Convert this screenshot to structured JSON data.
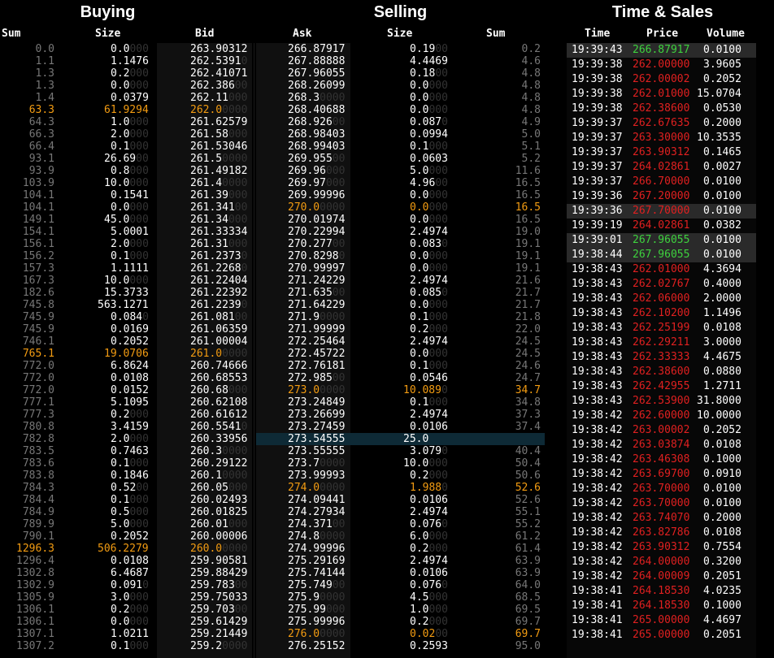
{
  "headers": {
    "buying": "Buying",
    "selling": "Selling",
    "time_sales": "Time & Sales"
  },
  "columns": {
    "buy_sum": "Sum",
    "buy_size": "Size",
    "bid": "Bid",
    "ask": "Ask",
    "sell_size": "Size",
    "sell_sum": "Sum",
    "time": "Time",
    "price": "Price",
    "volume": "Volume"
  },
  "colors": {
    "highlight": "#f39c12",
    "sell_price": "#e02020",
    "buy_price": "#3ed23e",
    "zero_pad": "#333333",
    "sum": "#777777"
  },
  "bids": [
    {
      "sum": "0.0",
      "size": "0.0",
      "size_pad": "000",
      "bid": "263.90312",
      "bid_pad": ""
    },
    {
      "sum": "1.1",
      "size": "1.1476",
      "size_pad": "",
      "bid": "262.5391",
      "bid_pad": "0"
    },
    {
      "sum": "1.3",
      "size": "0.2",
      "size_pad": "000",
      "bid": "262.41071",
      "bid_pad": ""
    },
    {
      "sum": "1.3",
      "size": "0.0",
      "size_pad": "000",
      "bid": "262.386",
      "bid_pad": "00"
    },
    {
      "sum": "1.4",
      "size": "0.0379",
      "size_pad": "",
      "bid": "262.11",
      "bid_pad": "000"
    },
    {
      "sum": "63.3",
      "size": "61.9294",
      "size_pad": "",
      "bid": "262.0",
      "bid_pad": "0000",
      "hl": true
    },
    {
      "sum": "64.3",
      "size": "1.0",
      "size_pad": "000",
      "bid": "261.62579",
      "bid_pad": ""
    },
    {
      "sum": "66.3",
      "size": "2.0",
      "size_pad": "000",
      "bid": "261.58",
      "bid_pad": "000"
    },
    {
      "sum": "66.4",
      "size": "0.1",
      "size_pad": "000",
      "bid": "261.53046",
      "bid_pad": ""
    },
    {
      "sum": "93.1",
      "size": "26.69",
      "size_pad": "00",
      "bid": "261.5",
      "bid_pad": "0000"
    },
    {
      "sum": "93.9",
      "size": "0.8",
      "size_pad": "000",
      "bid": "261.49182",
      "bid_pad": ""
    },
    {
      "sum": "103.9",
      "size": "10.0",
      "size_pad": "000",
      "bid": "261.4",
      "bid_pad": "0000"
    },
    {
      "sum": "104.1",
      "size": "0.1541",
      "size_pad": "",
      "bid": "261.39",
      "bid_pad": "000"
    },
    {
      "sum": "104.1",
      "size": "0.0",
      "size_pad": "000",
      "bid": "261.341",
      "bid_pad": "00"
    },
    {
      "sum": "149.1",
      "size": "45.0",
      "size_pad": "000",
      "bid": "261.34",
      "bid_pad": "000"
    },
    {
      "sum": "154.1",
      "size": "5.0001",
      "size_pad": "",
      "bid": "261.33334",
      "bid_pad": ""
    },
    {
      "sum": "156.1",
      "size": "2.0",
      "size_pad": "000",
      "bid": "261.31",
      "bid_pad": "000"
    },
    {
      "sum": "156.2",
      "size": "0.1",
      "size_pad": "000",
      "bid": "261.2373",
      "bid_pad": "0"
    },
    {
      "sum": "157.3",
      "size": "1.1111",
      "size_pad": "",
      "bid": "261.2268",
      "bid_pad": "0"
    },
    {
      "sum": "167.3",
      "size": "10.0",
      "size_pad": "000",
      "bid": "261.22404",
      "bid_pad": ""
    },
    {
      "sum": "182.6",
      "size": "15.3733",
      "size_pad": "",
      "bid": "261.22392",
      "bid_pad": ""
    },
    {
      "sum": "745.8",
      "size": "563.1271",
      "size_pad": "",
      "bid": "261.2239",
      "bid_pad": "0"
    },
    {
      "sum": "745.9",
      "size": "0.084",
      "size_pad": "0",
      "bid": "261.081",
      "bid_pad": "00"
    },
    {
      "sum": "745.9",
      "size": "0.0169",
      "size_pad": "",
      "bid": "261.06359",
      "bid_pad": ""
    },
    {
      "sum": "746.1",
      "size": "0.2052",
      "size_pad": "",
      "bid": "261.00004",
      "bid_pad": ""
    },
    {
      "sum": "765.1",
      "size": "19.0706",
      "size_pad": "",
      "bid": "261.0",
      "bid_pad": "0000",
      "hl": true
    },
    {
      "sum": "772.0",
      "size": "6.8624",
      "size_pad": "",
      "bid": "260.74666",
      "bid_pad": ""
    },
    {
      "sum": "772.0",
      "size": "0.0108",
      "size_pad": "",
      "bid": "260.68553",
      "bid_pad": ""
    },
    {
      "sum": "772.0",
      "size": "0.0152",
      "size_pad": "",
      "bid": "260.68",
      "bid_pad": "000"
    },
    {
      "sum": "777.1",
      "size": "5.1095",
      "size_pad": "",
      "bid": "260.62108",
      "bid_pad": ""
    },
    {
      "sum": "777.3",
      "size": "0.2",
      "size_pad": "000",
      "bid": "260.61612",
      "bid_pad": ""
    },
    {
      "sum": "780.8",
      "size": "3.4159",
      "size_pad": "",
      "bid": "260.5541",
      "bid_pad": "0"
    },
    {
      "sum": "782.8",
      "size": "2.0",
      "size_pad": "000",
      "bid": "260.33956",
      "bid_pad": ""
    },
    {
      "sum": "783.5",
      "size": "0.7463",
      "size_pad": "",
      "bid": "260.3",
      "bid_pad": "0000"
    },
    {
      "sum": "783.6",
      "size": "0.1",
      "size_pad": "000",
      "bid": "260.29122",
      "bid_pad": ""
    },
    {
      "sum": "783.8",
      "size": "0.1846",
      "size_pad": "",
      "bid": "260.1",
      "bid_pad": "0000"
    },
    {
      "sum": "784.3",
      "size": "0.52",
      "size_pad": "00",
      "bid": "260.05",
      "bid_pad": "000"
    },
    {
      "sum": "784.4",
      "size": "0.1",
      "size_pad": "000",
      "bid": "260.02493",
      "bid_pad": ""
    },
    {
      "sum": "784.9",
      "size": "0.5",
      "size_pad": "000",
      "bid": "260.01825",
      "bid_pad": ""
    },
    {
      "sum": "789.9",
      "size": "5.0",
      "size_pad": "000",
      "bid": "260.01",
      "bid_pad": "000"
    },
    {
      "sum": "790.1",
      "size": "0.2052",
      "size_pad": "",
      "bid": "260.00006",
      "bid_pad": ""
    },
    {
      "sum": "1296.3",
      "size": "506.2279",
      "size_pad": "",
      "bid": "260.0",
      "bid_pad": "0000",
      "hl": true
    },
    {
      "sum": "1296.4",
      "size": "0.0108",
      "size_pad": "",
      "bid": "259.90581",
      "bid_pad": ""
    },
    {
      "sum": "1302.8",
      "size": "6.4687",
      "size_pad": "",
      "bid": "259.88429",
      "bid_pad": ""
    },
    {
      "sum": "1302.9",
      "size": "0.091",
      "size_pad": "0",
      "bid": "259.783",
      "bid_pad": "00"
    },
    {
      "sum": "1305.9",
      "size": "3.0",
      "size_pad": "000",
      "bid": "259.75033",
      "bid_pad": ""
    },
    {
      "sum": "1306.1",
      "size": "0.2",
      "size_pad": "000",
      "bid": "259.703",
      "bid_pad": "00"
    },
    {
      "sum": "1306.1",
      "size": "0.0",
      "size_pad": "000",
      "bid": "259.61429",
      "bid_pad": ""
    },
    {
      "sum": "1307.1",
      "size": "1.0211",
      "size_pad": "",
      "bid": "259.21449",
      "bid_pad": ""
    },
    {
      "sum": "1307.2",
      "size": "0.1",
      "size_pad": "000",
      "bid": "259.2",
      "bid_pad": "0000"
    }
  ],
  "asks": [
    {
      "ask": "266.87917",
      "ask_pad": "",
      "size": "0.19",
      "size_pad": "00",
      "sum": "0.2"
    },
    {
      "ask": "267.88888",
      "ask_pad": "",
      "size": "4.4469",
      "size_pad": "",
      "sum": "4.6"
    },
    {
      "ask": "267.96055",
      "ask_pad": "",
      "size": "0.18",
      "size_pad": "00",
      "sum": "4.8"
    },
    {
      "ask": "268.26099",
      "ask_pad": "",
      "size": "0.0",
      "size_pad": "000",
      "sum": "4.8"
    },
    {
      "ask": "268.3",
      "ask_pad": "0000",
      "size": "0.0",
      "size_pad": "000",
      "sum": "4.8"
    },
    {
      "ask": "268.40688",
      "ask_pad": "",
      "size": "0.0",
      "size_pad": "000",
      "sum": "4.8"
    },
    {
      "ask": "268.926",
      "ask_pad": "00",
      "size": "0.087",
      "size_pad": "0",
      "sum": "4.9"
    },
    {
      "ask": "268.98403",
      "ask_pad": "",
      "size": "0.0994",
      "size_pad": "",
      "sum": "5.0"
    },
    {
      "ask": "268.99403",
      "ask_pad": "",
      "size": "0.1",
      "size_pad": "000",
      "sum": "5.1"
    },
    {
      "ask": "269.955",
      "ask_pad": "00",
      "size": "0.0603",
      "size_pad": "",
      "sum": "5.2"
    },
    {
      "ask": "269.96",
      "ask_pad": "000",
      "size": "5.0",
      "size_pad": "000",
      "sum": "11.6"
    },
    {
      "ask": "269.97",
      "ask_pad": "000",
      "size": "4.96",
      "size_pad": "00",
      "sum": "16.5"
    },
    {
      "ask": "269.99996",
      "ask_pad": "",
      "size": "0.0",
      "size_pad": "000",
      "sum": "16.5"
    },
    {
      "ask": "270.0",
      "ask_pad": "0000",
      "size": "0.0",
      "size_pad": "000",
      "sum": "16.5",
      "hl": true
    },
    {
      "ask": "270.01974",
      "ask_pad": "",
      "size": "0.0",
      "size_pad": "000",
      "sum": "16.5"
    },
    {
      "ask": "270.22994",
      "ask_pad": "",
      "size": "2.4974",
      "size_pad": "",
      "sum": "19.0"
    },
    {
      "ask": "270.277",
      "ask_pad": "00",
      "size": "0.083",
      "size_pad": "0",
      "sum": "19.1"
    },
    {
      "ask": "270.8298",
      "ask_pad": "0",
      "size": "0.0",
      "size_pad": "000",
      "sum": "19.1"
    },
    {
      "ask": "270.99997",
      "ask_pad": "",
      "size": "0.0",
      "size_pad": "000",
      "sum": "19.1"
    },
    {
      "ask": "271.24229",
      "ask_pad": "",
      "size": "2.4974",
      "size_pad": "",
      "sum": "21.6"
    },
    {
      "ask": "271.635",
      "ask_pad": "00",
      "size": "0.085",
      "size_pad": "0",
      "sum": "21.7"
    },
    {
      "ask": "271.64229",
      "ask_pad": "",
      "size": "0.0",
      "size_pad": "000",
      "sum": "21.7"
    },
    {
      "ask": "271.9",
      "ask_pad": "0000",
      "size": "0.1",
      "size_pad": "000",
      "sum": "21.8"
    },
    {
      "ask": "271.99999",
      "ask_pad": "",
      "size": "0.2",
      "size_pad": "000",
      "sum": "22.0"
    },
    {
      "ask": "272.25464",
      "ask_pad": "",
      "size": "2.4974",
      "size_pad": "",
      "sum": "24.5"
    },
    {
      "ask": "272.45722",
      "ask_pad": "",
      "size": "0.0",
      "size_pad": "000",
      "sum": "24.5"
    },
    {
      "ask": "272.76181",
      "ask_pad": "",
      "size": "0.1",
      "size_pad": "000",
      "sum": "24.6"
    },
    {
      "ask": "272.985",
      "ask_pad": "00",
      "size": "0.0546",
      "size_pad": "",
      "sum": "24.7"
    },
    {
      "ask": "273.0",
      "ask_pad": "0000",
      "size": "10.089",
      "size_pad": "0",
      "sum": "34.7",
      "hl": true
    },
    {
      "ask": "273.24849",
      "ask_pad": "",
      "size": "0.1",
      "size_pad": "000",
      "sum": "34.8"
    },
    {
      "ask": "273.26699",
      "ask_pad": "",
      "size": "2.4974",
      "size_pad": "",
      "sum": "37.3"
    },
    {
      "ask": "273.27459",
      "ask_pad": "",
      "size": "0.0106",
      "size_pad": "",
      "sum": "37.4"
    },
    {
      "ask": "273.54555",
      "ask_pad": "",
      "size": "25.0",
      "size_pad": "",
      "sum": "",
      "sel": true
    },
    {
      "ask": "273.55555",
      "ask_pad": "",
      "size": "3.079",
      "size_pad": "0",
      "sum": "40.4"
    },
    {
      "ask": "273.7",
      "ask_pad": "0000",
      "size": "10.0",
      "size_pad": "000",
      "sum": "50.4"
    },
    {
      "ask": "273.99993",
      "ask_pad": "",
      "size": "0.2",
      "size_pad": "000",
      "sum": "50.6"
    },
    {
      "ask": "274.0",
      "ask_pad": "0000",
      "size": "1.988",
      "size_pad": "0",
      "sum": "52.6",
      "hl": true
    },
    {
      "ask": "274.09441",
      "ask_pad": "",
      "size": "0.0106",
      "size_pad": "",
      "sum": "52.6"
    },
    {
      "ask": "274.27934",
      "ask_pad": "",
      "size": "2.4974",
      "size_pad": "",
      "sum": "55.1"
    },
    {
      "ask": "274.371",
      "ask_pad": "00",
      "size": "0.076",
      "size_pad": "0",
      "sum": "55.2"
    },
    {
      "ask": "274.8",
      "ask_pad": "0000",
      "size": "6.0",
      "size_pad": "000",
      "sum": "61.2"
    },
    {
      "ask": "274.99996",
      "ask_pad": "",
      "size": "0.2",
      "size_pad": "000",
      "sum": "61.4"
    },
    {
      "ask": "275.29169",
      "ask_pad": "",
      "size": "2.4974",
      "size_pad": "",
      "sum": "63.9"
    },
    {
      "ask": "275.74144",
      "ask_pad": "",
      "size": "0.0106",
      "size_pad": "",
      "sum": "63.9"
    },
    {
      "ask": "275.749",
      "ask_pad": "00",
      "size": "0.076",
      "size_pad": "0",
      "sum": "64.0"
    },
    {
      "ask": "275.9",
      "ask_pad": "0000",
      "size": "4.5",
      "size_pad": "000",
      "sum": "68.5"
    },
    {
      "ask": "275.99",
      "ask_pad": "000",
      "size": "1.0",
      "size_pad": "000",
      "sum": "69.5"
    },
    {
      "ask": "275.99996",
      "ask_pad": "",
      "size": "0.2",
      "size_pad": "000",
      "sum": "69.7"
    },
    {
      "ask": "276.0",
      "ask_pad": "0000",
      "size": "0.02",
      "size_pad": "00",
      "sum": "69.7",
      "hl": true
    },
    {
      "ask": "276.25152",
      "ask_pad": "",
      "size": "0.2593",
      "size_pad": "",
      "sum": "95.0"
    }
  ],
  "trades": [
    {
      "time": "19:39:43",
      "price": "266.87917",
      "side": "buy",
      "volume": "0.0100",
      "hl": true
    },
    {
      "time": "19:39:38",
      "price": "262.00000",
      "side": "sell",
      "volume": "3.9605"
    },
    {
      "time": "19:39:38",
      "price": "262.00002",
      "side": "sell",
      "volume": "0.2052"
    },
    {
      "time": "19:39:38",
      "price": "262.01000",
      "side": "sell",
      "volume": "15.0704"
    },
    {
      "time": "19:39:38",
      "price": "262.38600",
      "side": "sell",
      "volume": "0.0530"
    },
    {
      "time": "19:39:37",
      "price": "262.67635",
      "side": "sell",
      "volume": "0.2000"
    },
    {
      "time": "19:39:37",
      "price": "263.30000",
      "side": "sell",
      "volume": "10.3535"
    },
    {
      "time": "19:39:37",
      "price": "263.90312",
      "side": "sell",
      "volume": "0.1465"
    },
    {
      "time": "19:39:37",
      "price": "264.02861",
      "side": "sell",
      "volume": "0.0027"
    },
    {
      "time": "19:39:37",
      "price": "266.70000",
      "side": "sell",
      "volume": "0.0100"
    },
    {
      "time": "19:39:36",
      "price": "267.20000",
      "side": "sell",
      "volume": "0.0100"
    },
    {
      "time": "19:39:36",
      "price": "267.70000",
      "side": "sell",
      "volume": "0.0100",
      "hl": true
    },
    {
      "time": "19:39:19",
      "price": "264.02861",
      "side": "sell",
      "volume": "0.0382"
    },
    {
      "time": "19:39:01",
      "price": "267.96055",
      "side": "buy",
      "volume": "0.0100",
      "hl": true
    },
    {
      "time": "19:38:44",
      "price": "267.96055",
      "side": "buy",
      "volume": "0.0100",
      "hl": true
    },
    {
      "time": "19:38:43",
      "price": "262.01000",
      "side": "sell",
      "volume": "4.3694"
    },
    {
      "time": "19:38:43",
      "price": "262.02767",
      "side": "sell",
      "volume": "0.4000"
    },
    {
      "time": "19:38:43",
      "price": "262.06000",
      "side": "sell",
      "volume": "2.0000"
    },
    {
      "time": "19:38:43",
      "price": "262.10200",
      "side": "sell",
      "volume": "1.1496"
    },
    {
      "time": "19:38:43",
      "price": "262.25199",
      "side": "sell",
      "volume": "0.0108"
    },
    {
      "time": "19:38:43",
      "price": "262.29211",
      "side": "sell",
      "volume": "3.0000"
    },
    {
      "time": "19:38:43",
      "price": "262.33333",
      "side": "sell",
      "volume": "4.4675"
    },
    {
      "time": "19:38:43",
      "price": "262.38600",
      "side": "sell",
      "volume": "0.0880"
    },
    {
      "time": "19:38:43",
      "price": "262.42955",
      "side": "sell",
      "volume": "1.2711"
    },
    {
      "time": "19:38:43",
      "price": "262.53900",
      "side": "sell",
      "volume": "31.8000"
    },
    {
      "time": "19:38:42",
      "price": "262.60000",
      "side": "sell",
      "volume": "10.0000"
    },
    {
      "time": "19:38:42",
      "price": "263.00002",
      "side": "sell",
      "volume": "0.2052"
    },
    {
      "time": "19:38:42",
      "price": "263.03874",
      "side": "sell",
      "volume": "0.0108"
    },
    {
      "time": "19:38:42",
      "price": "263.46308",
      "side": "sell",
      "volume": "0.1000"
    },
    {
      "time": "19:38:42",
      "price": "263.69700",
      "side": "sell",
      "volume": "0.0910"
    },
    {
      "time": "19:38:42",
      "price": "263.70000",
      "side": "sell",
      "volume": "0.0100"
    },
    {
      "time": "19:38:42",
      "price": "263.70000",
      "side": "sell",
      "volume": "0.0100"
    },
    {
      "time": "19:38:42",
      "price": "263.74070",
      "side": "sell",
      "volume": "0.2000"
    },
    {
      "time": "19:38:42",
      "price": "263.82786",
      "side": "sell",
      "volume": "0.0108"
    },
    {
      "time": "19:38:42",
      "price": "263.90312",
      "side": "sell",
      "volume": "0.7554"
    },
    {
      "time": "19:38:42",
      "price": "264.00000",
      "side": "sell",
      "volume": "0.3200"
    },
    {
      "time": "19:38:42",
      "price": "264.00009",
      "side": "sell",
      "volume": "0.2051"
    },
    {
      "time": "19:38:41",
      "price": "264.18530",
      "side": "sell",
      "volume": "4.0235"
    },
    {
      "time": "19:38:41",
      "price": "264.18530",
      "side": "sell",
      "volume": "0.1000"
    },
    {
      "time": "19:38:41",
      "price": "265.00000",
      "side": "sell",
      "volume": "4.4697"
    },
    {
      "time": "19:38:41",
      "price": "265.00000",
      "side": "sell",
      "volume": "0.2051"
    }
  ]
}
